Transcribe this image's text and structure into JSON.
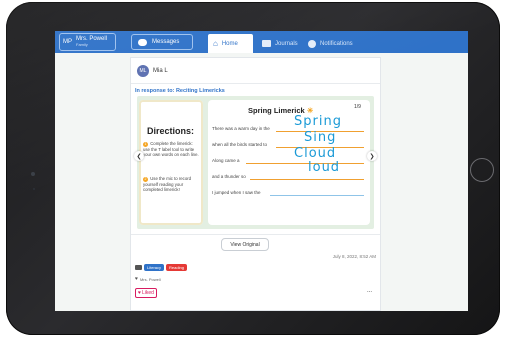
{
  "topbar": {
    "user_initials": "MP",
    "user_name": "Mrs. Powell",
    "user_role": "Family",
    "messages_label": "Messages",
    "tabs": [
      {
        "label": "Home",
        "active": true
      },
      {
        "label": "Journals",
        "active": false
      },
      {
        "label": "Notifications",
        "active": false
      }
    ]
  },
  "post": {
    "author_initials": "ML",
    "author_name": "Mia L",
    "response_prefix": "In response to:",
    "response_title": "Reciting Limericks",
    "worksheet": {
      "directions_title": "Directions:",
      "directions": [
        {
          "num": "1",
          "text": "Complete the limerick: use the T label tool to write your own words on each line."
        },
        {
          "num": "2",
          "text": "Use the mic to record yourself reading your completed limerick!"
        }
      ],
      "page_title": "Spring Limerick",
      "page_counter": "1/9",
      "lines": [
        {
          "prompt": "There was a warm day in the",
          "answer": "Spring"
        },
        {
          "prompt": "when all the birds started to",
          "answer": "Sing"
        },
        {
          "prompt": "Along came a",
          "answer": "Cloud"
        },
        {
          "prompt": "and a thunder so",
          "answer": "loud"
        },
        {
          "prompt": "I jumped when I saw the",
          "answer": ""
        }
      ]
    },
    "view_original_label": "View Original",
    "timestamp": "July 8, 2022, 8:52 AM",
    "tags": [
      {
        "label": "Literacy",
        "color": "#2f72c8"
      },
      {
        "label": "Reading",
        "color": "#e53935"
      }
    ],
    "liked_by": "Mrs. Powell",
    "like_label": "Liked",
    "more_label": "..."
  },
  "colors": {
    "topbar": "#2f72c8",
    "accent": "#2f72c8",
    "like": "#d81b60",
    "handwriting": "#1b9ad6",
    "blank_line": "#f0a030"
  }
}
